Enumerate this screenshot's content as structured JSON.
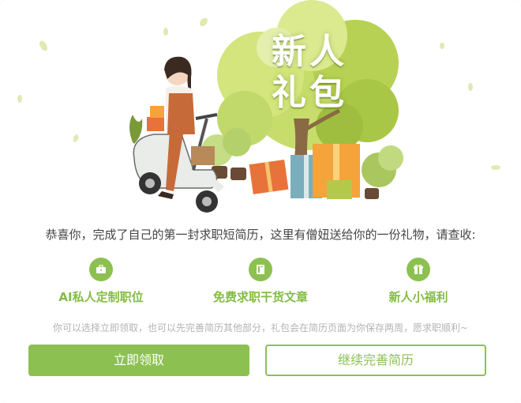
{
  "hero": {
    "title_line1": "新人",
    "title_line2": "礼包"
  },
  "message": "恭喜你，完成了自己的第一封求职短简历，这里有僧妞送给你的一份礼物，请查收:",
  "benefits": [
    {
      "label": "AI私人定制职位",
      "icon": "briefcase-icon"
    },
    {
      "label": "免费求职干货文章",
      "icon": "book-icon"
    },
    {
      "label": "新人小福利",
      "icon": "gift-icon"
    }
  ],
  "note": "你可以选择立即领取，也可以先完善简历其他部分，礼包会在简历页面为你保存两周，愿求职顺利~",
  "buttons": {
    "claim": "立即领取",
    "continue": "继续完善简历"
  },
  "colors": {
    "accent": "#8cc152",
    "accent_text": "#83bc45"
  }
}
